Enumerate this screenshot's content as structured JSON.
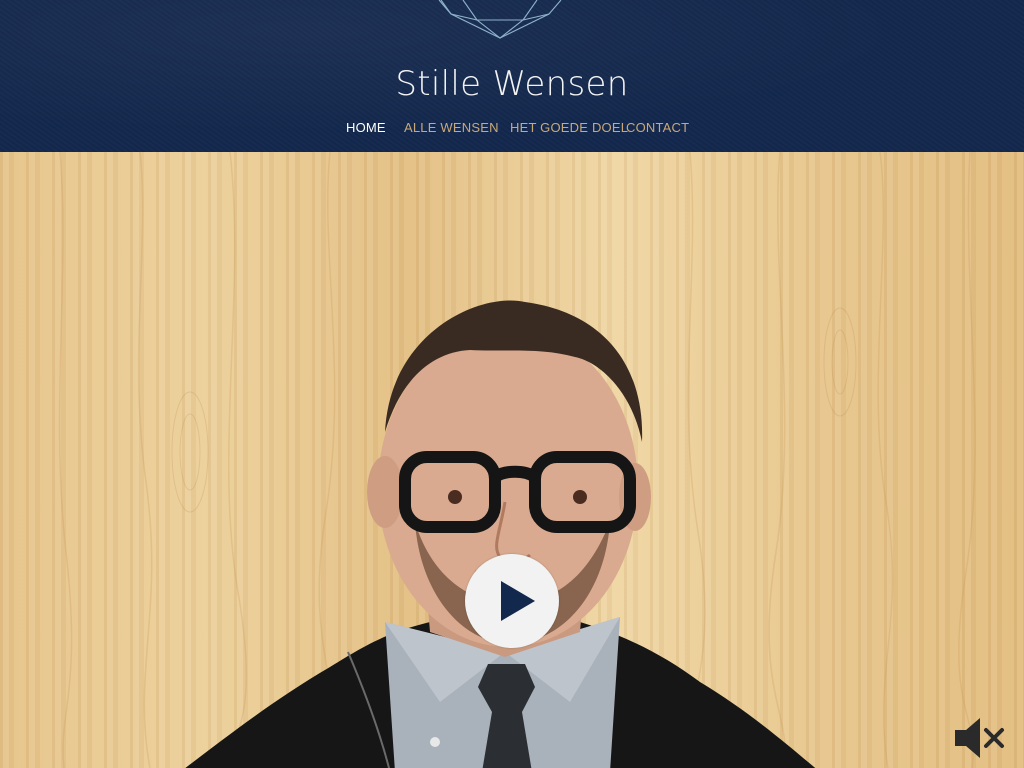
{
  "header": {
    "site_title": "Stille Wensen",
    "logo_icon": "geometric-diamond-logo"
  },
  "nav": {
    "items": [
      {
        "label": "HOME",
        "active": true
      },
      {
        "label": "ALLE WENSEN",
        "active": false
      },
      {
        "label": "HET GOEDE DOEL",
        "active": false
      },
      {
        "label": "CONTACT",
        "active": false
      }
    ]
  },
  "media": {
    "play_icon": "play-icon",
    "mute_icon": "volume-muted-icon",
    "background": "wood-texture"
  },
  "colors": {
    "header_bg": "#13284d",
    "nav_active": "#ffffff",
    "nav_item": "#c9a97a",
    "play_glyph": "#13284d"
  }
}
